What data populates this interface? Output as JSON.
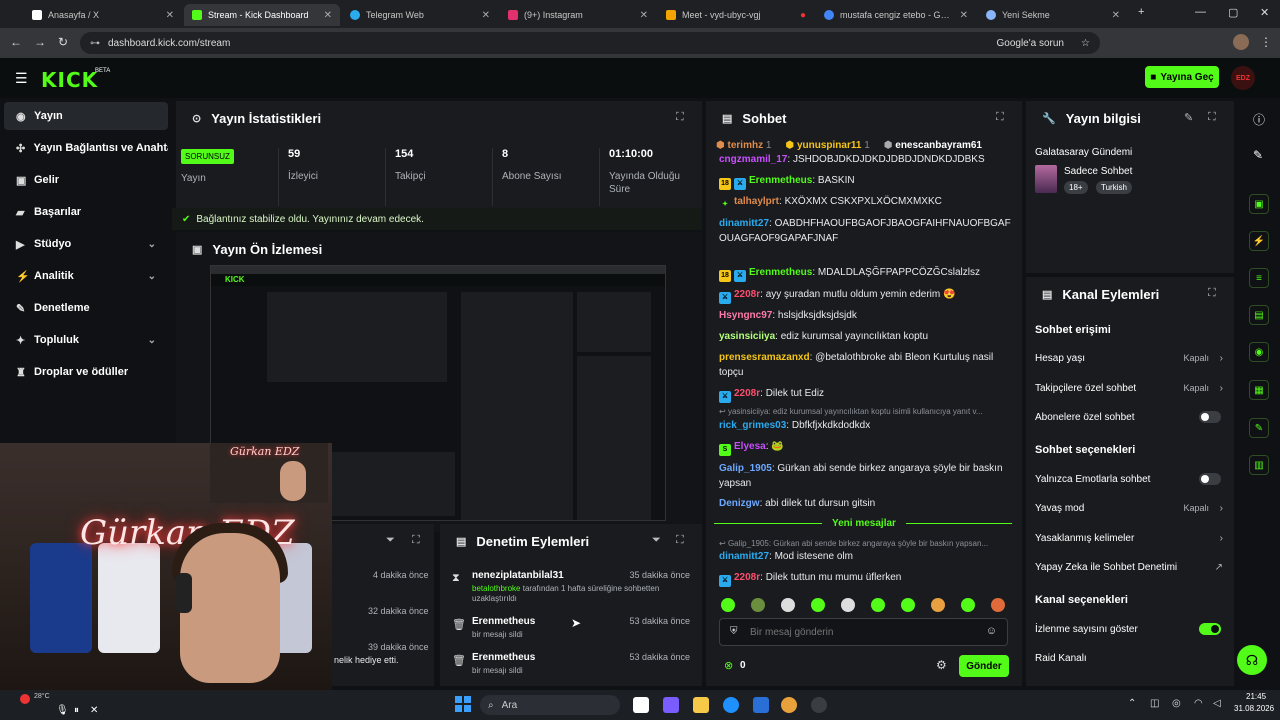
{
  "browser": {
    "tabs": [
      {
        "label": "Anasayfa / X",
        "color": "#ffffff"
      },
      {
        "label": "Stream - Kick Dashboard",
        "color": "#53fc18"
      },
      {
        "label": "Telegram Web",
        "color": "#2aabee"
      },
      {
        "label": "(9+) Instagram",
        "color": "#e1306c"
      },
      {
        "label": "Meet - vyd-ubyc-vgj",
        "color": "#f5a300"
      },
      {
        "label": "mustafa cengiz etebo - Google",
        "color": "#4285f4"
      },
      {
        "label": "Yeni Sekme",
        "color": "#8ab4f8"
      }
    ],
    "url": "dashboard.kick.com/stream",
    "google_lens": "Google'a sorun"
  },
  "header": {
    "logo": "KICK",
    "beta": "BETA",
    "go_live": "Yayına Geç",
    "avatar_text": "EDZ"
  },
  "nav": [
    {
      "label": "Yayın",
      "icon": "broadcast-icon",
      "glyph": "◉"
    },
    {
      "label": "Yayın Bağlantısı ve Anahtar",
      "icon": "link-icon",
      "glyph": "✣"
    },
    {
      "label": "Gelir",
      "icon": "wallet-icon",
      "glyph": "▣"
    },
    {
      "label": "Başarılar",
      "icon": "trophy-icon",
      "glyph": "▰"
    },
    {
      "label": "Stüdyo",
      "icon": "studio-icon",
      "glyph": "▶"
    },
    {
      "label": "Analitik",
      "icon": "analytics-icon",
      "glyph": "⚡"
    },
    {
      "label": "Denetleme",
      "icon": "moderation-icon",
      "glyph": "✎"
    },
    {
      "label": "Topluluk",
      "icon": "community-icon",
      "glyph": "✦"
    },
    {
      "label": "Droplar ve ödüller",
      "icon": "drops-icon",
      "glyph": "♜"
    }
  ],
  "stats": {
    "title": "Yayın İstatistikleri",
    "status_badge": "SORUNSUZ",
    "items": [
      {
        "value": "",
        "label": "Yayın"
      },
      {
        "value": "59",
        "label": "İzleyici"
      },
      {
        "value": "154",
        "label": "Takipçi"
      },
      {
        "value": "8",
        "label": "Abone Sayısı"
      },
      {
        "value": "01:10:00",
        "label": "Yayında Olduğu Süre"
      }
    ],
    "stable_msg": "Bağlantınız stabilize oldu. Yayınınız devam edecek."
  },
  "preview": {
    "title": "Yayın Ön İzlemesi"
  },
  "webcam": {
    "neon_text": "Gürkan EDZ"
  },
  "left_overflow": {
    "times": [
      "4 dakika önce",
      "32 dakika önce",
      "39 dakika önce"
    ],
    "snippet": "nelik hediye etti."
  },
  "audit": {
    "title": "Denetim Eylemleri",
    "rows": [
      {
        "icon": "hourglass-icon",
        "glyph": "⧗",
        "name": "neneziplatanbilal31",
        "time": "35 dakika önce",
        "by": "betalothbroke",
        "desc": "tarafından 1 hafta süreliğine sohbetten uzaklaştırıldı"
      },
      {
        "icon": "trash-icon",
        "glyph": "🗑",
        "name": "Erenmetheus",
        "time": "53 dakika önce",
        "by": "",
        "desc": "bir mesajı sildi"
      },
      {
        "icon": "trash-icon",
        "glyph": "🗑",
        "name": "Erenmetheus",
        "time": "53 dakika önce",
        "by": "",
        "desc": "bir mesajı sildi"
      }
    ]
  },
  "chat": {
    "title": "Sohbet",
    "top_users": [
      {
        "name": "terimhz",
        "count": "1",
        "color": "#e08c4b"
      },
      {
        "name": "yunuspinar11",
        "count": "1",
        "color": "#f5c518"
      },
      {
        "name": "enescanbayram61",
        "count": "",
        "color": "#ffffff"
      }
    ],
    "messages": [
      {
        "user": "cngzmamil_17",
        "color": "#c94fff",
        "badges": [],
        "text": "JSHDOBJDKDJDKDJDBDJDNDKDJDBKS"
      },
      {
        "user": "Erenmetheus",
        "color": "#53fc18",
        "badges": [
          "#f5c518",
          "#2aabee"
        ],
        "text": "BASKIN"
      },
      {
        "user": "talhaylprt",
        "color": "#e08c4b",
        "badges": [
          "#53fc18"
        ],
        "text": "KXÖXMX CSKXPXLXÖCMXMXKC"
      },
      {
        "user": "dinamitt27",
        "color": "#2aabee",
        "badges": [],
        "text": "OABDHFHAOUFBGAOFJBAOGFAIHFNAUOFBGAFOUAGFAOF9GAPAFJNAF"
      },
      {
        "user": "Erenmetheus",
        "color": "#53fc18",
        "badges": [
          "#f5c518",
          "#2aabee"
        ],
        "text": "MDALDLAŞĞFPAPPCÖZĞCslalzlsz"
      },
      {
        "user": "2208r",
        "color": "#ff4d6d",
        "badges": [
          "#2aabee"
        ],
        "text": "ayy şuradan mutlu oldum yemin ederim 😍"
      },
      {
        "user": "Hsyngnc97",
        "color": "#ff7aa8",
        "badges": [],
        "text": "hslsjdksjdksjdsjdk"
      },
      {
        "user": "yasinsiciiya",
        "color": "#b4ff7a",
        "badges": [],
        "text": "ediz kurumsal yayıncılıktan koptu"
      },
      {
        "user": "prensesramazanxd",
        "color": "#f5c518",
        "badges": [],
        "text": "@betalothbroke abi Bleon Kurtuluş nasil topçu"
      },
      {
        "user": "2208r",
        "color": "#ff4d6d",
        "badges": [
          "#2aabee"
        ],
        "text": "Dilek tut Ediz"
      },
      {
        "user": "rick_grimes03",
        "color": "#2aabee",
        "badges": [],
        "text": "Dbfkfjxkdkdodkdx"
      },
      {
        "user": "Elyesa",
        "color": "#c94fff",
        "badges": [
          "#53fc18"
        ],
        "text": "🐸"
      },
      {
        "user": "Galip_1905",
        "color": "#6ea8ff",
        "badges": [],
        "text": "Gürkan abi sende birkez angaraya şöyle bir baskın yapsan"
      },
      {
        "user": "Denizgw",
        "color": "#6ea8ff",
        "badges": [],
        "text": "abi dilek tut dursun gitsin"
      },
      {
        "user": "dinamitt27",
        "color": "#2aabee",
        "badges": [],
        "text": "Mod istesene olm"
      },
      {
        "user": "2208r",
        "color": "#ff4d6d",
        "badges": [
          "#2aabee"
        ],
        "text": "Dilek tuttun mu mumu üflerken"
      }
    ],
    "reply1": "yasinsiciiya: ediz kurumsal yayıncılıktan koptu isimli kullanıcıya yanıt v...",
    "new_messages": "Yeni mesajlar",
    "reply2": "Galip_1905: Gürkan abi sende birkez angaraya şöyle bir baskın yapsan...",
    "input_placeholder": "Bir mesaj gönderin",
    "points": "0",
    "send": "Gönder"
  },
  "stream_info": {
    "title": "Yayın bilgisi",
    "stream_title": "Galatasaray Gündemi",
    "category": "Sadece Sohbet",
    "tags": [
      "18+",
      "Turkish"
    ]
  },
  "channel_actions": {
    "title": "Kanal Eylemleri",
    "chat_access": "Sohbet erişimi",
    "account_age": {
      "label": "Hesap yaşı",
      "value": "Kapalı"
    },
    "followers_only": {
      "label": "Takipçilere özel sohbet",
      "value": "Kapalı"
    },
    "subs_only": {
      "label": "Abonelere özel sohbet"
    },
    "chat_options": "Sohbet seçenekleri",
    "emotes_only": {
      "label": "Yalnızca Emotlarla sohbet"
    },
    "slow_mode": {
      "label": "Yavaş mod",
      "value": "Kapalı"
    },
    "banned_words": {
      "label": "Yasaklanmış kelimeler"
    },
    "ai_moderation": {
      "label": "Yapay Zeka ile Sohbet Denetimi"
    },
    "channel_options": "Kanal seçenekleri",
    "show_viewers": {
      "label": "İzlenme sayısını göster"
    },
    "raid": {
      "label": "Raid Kanalı"
    }
  },
  "taskbar": {
    "search": "Ara",
    "time": "21:45",
    "date": "31.08.2026",
    "temp": "28°C"
  }
}
